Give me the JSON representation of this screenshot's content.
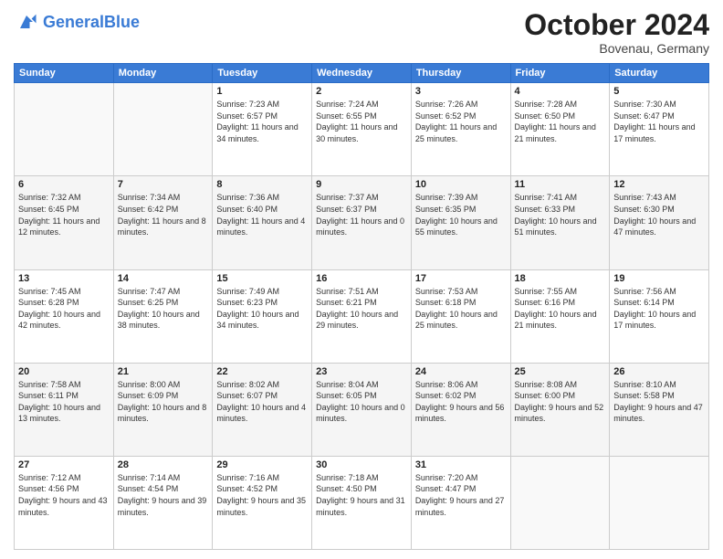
{
  "logo": {
    "text_general": "General",
    "text_blue": "Blue"
  },
  "header": {
    "month": "October 2024",
    "location": "Bovenau, Germany"
  },
  "weekdays": [
    "Sunday",
    "Monday",
    "Tuesday",
    "Wednesday",
    "Thursday",
    "Friday",
    "Saturday"
  ],
  "weeks": [
    [
      {
        "day": "",
        "sunrise": "",
        "sunset": "",
        "daylight": ""
      },
      {
        "day": "",
        "sunrise": "",
        "sunset": "",
        "daylight": ""
      },
      {
        "day": "1",
        "sunrise": "Sunrise: 7:23 AM",
        "sunset": "Sunset: 6:57 PM",
        "daylight": "Daylight: 11 hours and 34 minutes."
      },
      {
        "day": "2",
        "sunrise": "Sunrise: 7:24 AM",
        "sunset": "Sunset: 6:55 PM",
        "daylight": "Daylight: 11 hours and 30 minutes."
      },
      {
        "day": "3",
        "sunrise": "Sunrise: 7:26 AM",
        "sunset": "Sunset: 6:52 PM",
        "daylight": "Daylight: 11 hours and 25 minutes."
      },
      {
        "day": "4",
        "sunrise": "Sunrise: 7:28 AM",
        "sunset": "Sunset: 6:50 PM",
        "daylight": "Daylight: 11 hours and 21 minutes."
      },
      {
        "day": "5",
        "sunrise": "Sunrise: 7:30 AM",
        "sunset": "Sunset: 6:47 PM",
        "daylight": "Daylight: 11 hours and 17 minutes."
      }
    ],
    [
      {
        "day": "6",
        "sunrise": "Sunrise: 7:32 AM",
        "sunset": "Sunset: 6:45 PM",
        "daylight": "Daylight: 11 hours and 12 minutes."
      },
      {
        "day": "7",
        "sunrise": "Sunrise: 7:34 AM",
        "sunset": "Sunset: 6:42 PM",
        "daylight": "Daylight: 11 hours and 8 minutes."
      },
      {
        "day": "8",
        "sunrise": "Sunrise: 7:36 AM",
        "sunset": "Sunset: 6:40 PM",
        "daylight": "Daylight: 11 hours and 4 minutes."
      },
      {
        "day": "9",
        "sunrise": "Sunrise: 7:37 AM",
        "sunset": "Sunset: 6:37 PM",
        "daylight": "Daylight: 11 hours and 0 minutes."
      },
      {
        "day": "10",
        "sunrise": "Sunrise: 7:39 AM",
        "sunset": "Sunset: 6:35 PM",
        "daylight": "Daylight: 10 hours and 55 minutes."
      },
      {
        "day": "11",
        "sunrise": "Sunrise: 7:41 AM",
        "sunset": "Sunset: 6:33 PM",
        "daylight": "Daylight: 10 hours and 51 minutes."
      },
      {
        "day": "12",
        "sunrise": "Sunrise: 7:43 AM",
        "sunset": "Sunset: 6:30 PM",
        "daylight": "Daylight: 10 hours and 47 minutes."
      }
    ],
    [
      {
        "day": "13",
        "sunrise": "Sunrise: 7:45 AM",
        "sunset": "Sunset: 6:28 PM",
        "daylight": "Daylight: 10 hours and 42 minutes."
      },
      {
        "day": "14",
        "sunrise": "Sunrise: 7:47 AM",
        "sunset": "Sunset: 6:25 PM",
        "daylight": "Daylight: 10 hours and 38 minutes."
      },
      {
        "day": "15",
        "sunrise": "Sunrise: 7:49 AM",
        "sunset": "Sunset: 6:23 PM",
        "daylight": "Daylight: 10 hours and 34 minutes."
      },
      {
        "day": "16",
        "sunrise": "Sunrise: 7:51 AM",
        "sunset": "Sunset: 6:21 PM",
        "daylight": "Daylight: 10 hours and 29 minutes."
      },
      {
        "day": "17",
        "sunrise": "Sunrise: 7:53 AM",
        "sunset": "Sunset: 6:18 PM",
        "daylight": "Daylight: 10 hours and 25 minutes."
      },
      {
        "day": "18",
        "sunrise": "Sunrise: 7:55 AM",
        "sunset": "Sunset: 6:16 PM",
        "daylight": "Daylight: 10 hours and 21 minutes."
      },
      {
        "day": "19",
        "sunrise": "Sunrise: 7:56 AM",
        "sunset": "Sunset: 6:14 PM",
        "daylight": "Daylight: 10 hours and 17 minutes."
      }
    ],
    [
      {
        "day": "20",
        "sunrise": "Sunrise: 7:58 AM",
        "sunset": "Sunset: 6:11 PM",
        "daylight": "Daylight: 10 hours and 13 minutes."
      },
      {
        "day": "21",
        "sunrise": "Sunrise: 8:00 AM",
        "sunset": "Sunset: 6:09 PM",
        "daylight": "Daylight: 10 hours and 8 minutes."
      },
      {
        "day": "22",
        "sunrise": "Sunrise: 8:02 AM",
        "sunset": "Sunset: 6:07 PM",
        "daylight": "Daylight: 10 hours and 4 minutes."
      },
      {
        "day": "23",
        "sunrise": "Sunrise: 8:04 AM",
        "sunset": "Sunset: 6:05 PM",
        "daylight": "Daylight: 10 hours and 0 minutes."
      },
      {
        "day": "24",
        "sunrise": "Sunrise: 8:06 AM",
        "sunset": "Sunset: 6:02 PM",
        "daylight": "Daylight: 9 hours and 56 minutes."
      },
      {
        "day": "25",
        "sunrise": "Sunrise: 8:08 AM",
        "sunset": "Sunset: 6:00 PM",
        "daylight": "Daylight: 9 hours and 52 minutes."
      },
      {
        "day": "26",
        "sunrise": "Sunrise: 8:10 AM",
        "sunset": "Sunset: 5:58 PM",
        "daylight": "Daylight: 9 hours and 47 minutes."
      }
    ],
    [
      {
        "day": "27",
        "sunrise": "Sunrise: 7:12 AM",
        "sunset": "Sunset: 4:56 PM",
        "daylight": "Daylight: 9 hours and 43 minutes."
      },
      {
        "day": "28",
        "sunrise": "Sunrise: 7:14 AM",
        "sunset": "Sunset: 4:54 PM",
        "daylight": "Daylight: 9 hours and 39 minutes."
      },
      {
        "day": "29",
        "sunrise": "Sunrise: 7:16 AM",
        "sunset": "Sunset: 4:52 PM",
        "daylight": "Daylight: 9 hours and 35 minutes."
      },
      {
        "day": "30",
        "sunrise": "Sunrise: 7:18 AM",
        "sunset": "Sunset: 4:50 PM",
        "daylight": "Daylight: 9 hours and 31 minutes."
      },
      {
        "day": "31",
        "sunrise": "Sunrise: 7:20 AM",
        "sunset": "Sunset: 4:47 PM",
        "daylight": "Daylight: 9 hours and 27 minutes."
      },
      {
        "day": "",
        "sunrise": "",
        "sunset": "",
        "daylight": ""
      },
      {
        "day": "",
        "sunrise": "",
        "sunset": "",
        "daylight": ""
      }
    ]
  ]
}
